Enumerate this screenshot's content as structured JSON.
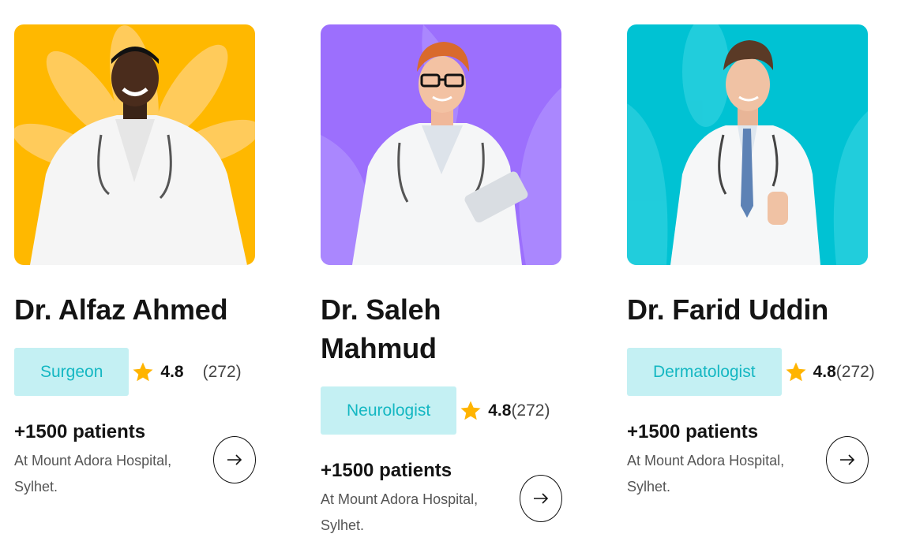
{
  "doctors": [
    {
      "name": "Dr. Alfaz Ahmed",
      "specialty": "Surgeon",
      "rating": "4.8",
      "reviews": "(272)",
      "patients": "+1500 patients",
      "location": "At Mount Adora Hospital, Sylhet.",
      "photo_bg": "#ffb800"
    },
    {
      "name": "Dr. Saleh Mahmud",
      "specialty": "Neurologist",
      "rating": "4.8",
      "reviews": "(272)",
      "patients": "+1500 patients",
      "location": "At Mount Adora Hospital, Sylhet.",
      "photo_bg": "#9c6ffd"
    },
    {
      "name": "Dr. Farid Uddin",
      "specialty": "Dermatologist",
      "rating": "4.8",
      "reviews": "(272)",
      "patients": "+1500 patients",
      "location": "At Mount Adora Hospital, Sylhet.",
      "photo_bg": "#00c2d3"
    }
  ],
  "icons": {
    "rating": "star-icon",
    "action": "arrow-right-icon"
  },
  "colors": {
    "tag_bg": "#c4f0f3",
    "tag_text": "#14b7c2",
    "star": "#ffb400"
  }
}
